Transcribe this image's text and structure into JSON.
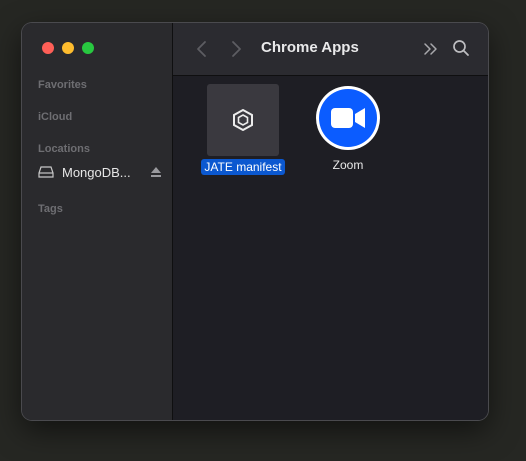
{
  "window": {
    "title": "Chrome Apps"
  },
  "sidebar": {
    "sections": {
      "favorites": "Favorites",
      "icloud": "iCloud",
      "locations": "Locations",
      "tags": "Tags"
    },
    "locations": [
      {
        "label": "MongoDB...",
        "icon": "drive-icon",
        "eject_icon": "eject-icon"
      }
    ]
  },
  "toolbar": {
    "back_icon": "chevron-left-icon",
    "forward_icon": "chevron-right-icon",
    "more_icon": "double-chevron-right-icon",
    "search_icon": "search-icon"
  },
  "files": [
    {
      "name": "JATE manifest",
      "selected": true,
      "icon": "jate-app-icon"
    },
    {
      "name": "Zoom",
      "selected": false,
      "icon": "zoom-app-icon"
    }
  ],
  "colors": {
    "selection": "#0b58d0",
    "zoom_blue": "#0b5cff",
    "close": "#fe5f57",
    "minimize": "#febc2e",
    "zoom_window": "#28c840"
  }
}
